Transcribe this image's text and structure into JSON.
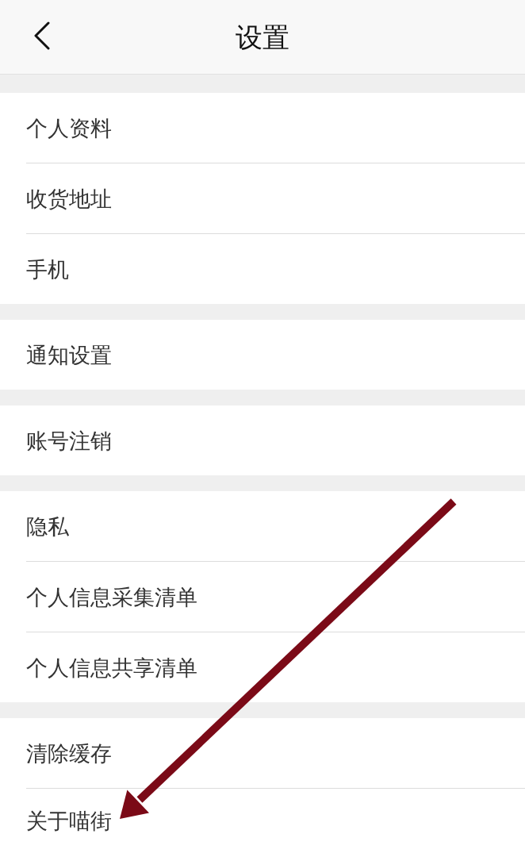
{
  "nav_bar": {
    "title": "设置"
  },
  "groups": [
    {
      "items": [
        {
          "label": "个人资料"
        },
        {
          "label": "收货地址"
        },
        {
          "label": "手机"
        }
      ]
    },
    {
      "items": [
        {
          "label": "通知设置"
        }
      ]
    },
    {
      "items": [
        {
          "label": "账号注销"
        }
      ]
    },
    {
      "items": [
        {
          "label": "隐私"
        },
        {
          "label": "个人信息采集清单"
        },
        {
          "label": "个人信息共享清单"
        }
      ]
    },
    {
      "items": [
        {
          "label": "清除缓存"
        },
        {
          "label": "关于喵街"
        }
      ]
    }
  ]
}
